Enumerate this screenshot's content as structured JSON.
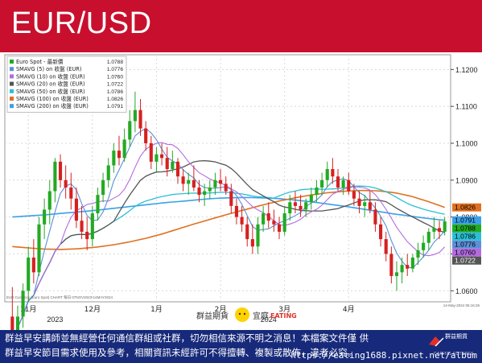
{
  "header": {
    "title": "EUR/USD",
    "bg_color": "#c8102e"
  },
  "chart_data": {
    "type": "line",
    "candles": [
      {
        "o": 1.053,
        "h": 1.061,
        "l": 1.045,
        "c": 1.047
      },
      {
        "o": 1.047,
        "h": 1.056,
        "l": 1.044,
        "c": 1.053
      },
      {
        "o": 1.053,
        "h": 1.062,
        "l": 1.05,
        "c": 1.06
      },
      {
        "o": 1.06,
        "h": 1.072,
        "l": 1.057,
        "c": 1.069
      },
      {
        "o": 1.069,
        "h": 1.074,
        "l": 1.062,
        "c": 1.065
      },
      {
        "o": 1.065,
        "h": 1.08,
        "l": 1.064,
        "c": 1.078
      },
      {
        "o": 1.078,
        "h": 1.085,
        "l": 1.074,
        "c": 1.082
      },
      {
        "o": 1.082,
        "h": 1.09,
        "l": 1.078,
        "c": 1.087
      },
      {
        "o": 1.087,
        "h": 1.096,
        "l": 1.084,
        "c": 1.095
      },
      {
        "o": 1.095,
        "h": 1.097,
        "l": 1.088,
        "c": 1.09
      },
      {
        "o": 1.09,
        "h": 1.094,
        "l": 1.085,
        "c": 1.088
      },
      {
        "o": 1.088,
        "h": 1.092,
        "l": 1.082,
        "c": 1.085
      },
      {
        "o": 1.085,
        "h": 1.088,
        "l": 1.077,
        "c": 1.079
      },
      {
        "o": 1.079,
        "h": 1.083,
        "l": 1.074,
        "c": 1.076
      },
      {
        "o": 1.076,
        "h": 1.08,
        "l": 1.071,
        "c": 1.074
      },
      {
        "o": 1.074,
        "h": 1.083,
        "l": 1.072,
        "c": 1.081
      },
      {
        "o": 1.081,
        "h": 1.088,
        "l": 1.079,
        "c": 1.086
      },
      {
        "o": 1.086,
        "h": 1.092,
        "l": 1.084,
        "c": 1.09
      },
      {
        "o": 1.09,
        "h": 1.096,
        "l": 1.088,
        "c": 1.094
      },
      {
        "o": 1.094,
        "h": 1.1,
        "l": 1.092,
        "c": 1.098
      },
      {
        "o": 1.098,
        "h": 1.102,
        "l": 1.094,
        "c": 1.096
      },
      {
        "o": 1.096,
        "h": 1.104,
        "l": 1.095,
        "c": 1.101
      },
      {
        "o": 1.101,
        "h": 1.109,
        "l": 1.099,
        "c": 1.106
      },
      {
        "o": 1.106,
        "h": 1.114,
        "l": 1.103,
        "c": 1.109
      },
      {
        "o": 1.109,
        "h": 1.112,
        "l": 1.102,
        "c": 1.104
      },
      {
        "o": 1.104,
        "h": 1.106,
        "l": 1.098,
        "c": 1.1
      },
      {
        "o": 1.1,
        "h": 1.102,
        "l": 1.093,
        "c": 1.095
      },
      {
        "o": 1.095,
        "h": 1.099,
        "l": 1.092,
        "c": 1.097
      },
      {
        "o": 1.097,
        "h": 1.1,
        "l": 1.094,
        "c": 1.096
      },
      {
        "o": 1.096,
        "h": 1.099,
        "l": 1.091,
        "c": 1.093
      },
      {
        "o": 1.093,
        "h": 1.098,
        "l": 1.092,
        "c": 1.095
      },
      {
        "o": 1.095,
        "h": 1.096,
        "l": 1.089,
        "c": 1.091
      },
      {
        "o": 1.091,
        "h": 1.093,
        "l": 1.087,
        "c": 1.089
      },
      {
        "o": 1.089,
        "h": 1.092,
        "l": 1.086,
        "c": 1.09
      },
      {
        "o": 1.09,
        "h": 1.094,
        "l": 1.087,
        "c": 1.088
      },
      {
        "o": 1.088,
        "h": 1.09,
        "l": 1.084,
        "c": 1.086
      },
      {
        "o": 1.086,
        "h": 1.089,
        "l": 1.083,
        "c": 1.087
      },
      {
        "o": 1.087,
        "h": 1.09,
        "l": 1.085,
        "c": 1.088
      },
      {
        "o": 1.088,
        "h": 1.092,
        "l": 1.086,
        "c": 1.09
      },
      {
        "o": 1.09,
        "h": 1.093,
        "l": 1.087,
        "c": 1.089
      },
      {
        "o": 1.089,
        "h": 1.091,
        "l": 1.086,
        "c": 1.087
      },
      {
        "o": 1.087,
        "h": 1.089,
        "l": 1.081,
        "c": 1.083
      },
      {
        "o": 1.083,
        "h": 1.085,
        "l": 1.078,
        "c": 1.08
      },
      {
        "o": 1.08,
        "h": 1.083,
        "l": 1.076,
        "c": 1.078
      },
      {
        "o": 1.078,
        "h": 1.08,
        "l": 1.072,
        "c": 1.074
      },
      {
        "o": 1.074,
        "h": 1.078,
        "l": 1.07,
        "c": 1.072
      },
      {
        "o": 1.072,
        "h": 1.08,
        "l": 1.07,
        "c": 1.078
      },
      {
        "o": 1.078,
        "h": 1.083,
        "l": 1.076,
        "c": 1.081
      },
      {
        "o": 1.081,
        "h": 1.084,
        "l": 1.077,
        "c": 1.079
      },
      {
        "o": 1.079,
        "h": 1.082,
        "l": 1.076,
        "c": 1.078
      },
      {
        "o": 1.078,
        "h": 1.08,
        "l": 1.074,
        "c": 1.076
      },
      {
        "o": 1.076,
        "h": 1.083,
        "l": 1.075,
        "c": 1.081
      },
      {
        "o": 1.081,
        "h": 1.086,
        "l": 1.079,
        "c": 1.084
      },
      {
        "o": 1.084,
        "h": 1.087,
        "l": 1.081,
        "c": 1.083
      },
      {
        "o": 1.083,
        "h": 1.086,
        "l": 1.08,
        "c": 1.082
      },
      {
        "o": 1.082,
        "h": 1.085,
        "l": 1.08,
        "c": 1.084
      },
      {
        "o": 1.084,
        "h": 1.088,
        "l": 1.082,
        "c": 1.086
      },
      {
        "o": 1.086,
        "h": 1.09,
        "l": 1.084,
        "c": 1.088
      },
      {
        "o": 1.088,
        "h": 1.092,
        "l": 1.086,
        "c": 1.09
      },
      {
        "o": 1.09,
        "h": 1.095,
        "l": 1.088,
        "c": 1.093
      },
      {
        "o": 1.093,
        "h": 1.096,
        "l": 1.089,
        "c": 1.091
      },
      {
        "o": 1.091,
        "h": 1.093,
        "l": 1.087,
        "c": 1.088
      },
      {
        "o": 1.088,
        "h": 1.091,
        "l": 1.086,
        "c": 1.09
      },
      {
        "o": 1.09,
        "h": 1.092,
        "l": 1.086,
        "c": 1.087
      },
      {
        "o": 1.087,
        "h": 1.089,
        "l": 1.083,
        "c": 1.085
      },
      {
        "o": 1.085,
        "h": 1.087,
        "l": 1.081,
        "c": 1.083
      },
      {
        "o": 1.083,
        "h": 1.086,
        "l": 1.08,
        "c": 1.084
      },
      {
        "o": 1.084,
        "h": 1.087,
        "l": 1.081,
        "c": 1.082
      },
      {
        "o": 1.082,
        "h": 1.084,
        "l": 1.076,
        "c": 1.078
      },
      {
        "o": 1.078,
        "h": 1.08,
        "l": 1.072,
        "c": 1.074
      },
      {
        "o": 1.074,
        "h": 1.076,
        "l": 1.068,
        "c": 1.07
      },
      {
        "o": 1.07,
        "h": 1.072,
        "l": 1.062,
        "c": 1.064
      },
      {
        "o": 1.064,
        "h": 1.068,
        "l": 1.06,
        "c": 1.065
      },
      {
        "o": 1.065,
        "h": 1.069,
        "l": 1.062,
        "c": 1.067
      },
      {
        "o": 1.067,
        "h": 1.07,
        "l": 1.064,
        "c": 1.066
      },
      {
        "o": 1.066,
        "h": 1.07,
        "l": 1.065,
        "c": 1.069
      },
      {
        "o": 1.069,
        "h": 1.073,
        "l": 1.067,
        "c": 1.071
      },
      {
        "o": 1.071,
        "h": 1.075,
        "l": 1.069,
        "c": 1.073
      },
      {
        "o": 1.073,
        "h": 1.077,
        "l": 1.071,
        "c": 1.076
      },
      {
        "o": 1.076,
        "h": 1.08,
        "l": 1.074,
        "c": 1.077
      },
      {
        "o": 1.077,
        "h": 1.079,
        "l": 1.074,
        "c": 1.076
      },
      {
        "o": 1.076,
        "h": 1.08,
        "l": 1.075,
        "c": 1.0788
      }
    ],
    "series": [
      {
        "name": "Euro Spot - 最新價",
        "last": "1.0788",
        "color": "#22aa22",
        "kind": "candle"
      },
      {
        "name": "SMAVG (5) on 收盤 (EUR)",
        "last": "1.0776",
        "color": "#5b8fd6",
        "kind": "line"
      },
      {
        "name": "SMAVG (10) on 收盤 (EUR)",
        "last": "1.0760",
        "color": "#b36be0",
        "kind": "line"
      },
      {
        "name": "SMAVG (20) on 收盤 (EUR)",
        "last": "1.0722",
        "color": "#555555",
        "kind": "line"
      },
      {
        "name": "SMAVG (50) on 收盤 (EUR)",
        "last": "1.0786",
        "color": "#2bbfd6",
        "kind": "line"
      },
      {
        "name": "SMAVG (100) on 收盤 (EUR)",
        "last": "1.0826",
        "color": "#e07020",
        "kind": "line"
      },
      {
        "name": "SMAVG (200) on 收盤 (EUR)",
        "last": "1.0791",
        "color": "#3aa0e8",
        "kind": "line"
      }
    ],
    "ma200": [
      1.08,
      1.0803,
      1.0806,
      1.081,
      1.0814,
      1.0818,
      1.0823,
      1.0828,
      1.0833,
      1.0838,
      1.0842,
      1.0846,
      1.085,
      1.0852,
      1.0853,
      1.0852,
      1.085,
      1.0846,
      1.0841,
      1.0835,
      1.0829,
      1.0822,
      1.0815,
      1.0808,
      1.0802,
      1.0796,
      1.0791
    ],
    "ma100": [
      1.072,
      1.0716,
      1.0713,
      1.0712,
      1.0714,
      1.0718,
      1.0724,
      1.0732,
      1.0742,
      1.0754,
      1.0768,
      1.0782,
      1.0795,
      1.0808,
      1.082,
      1.0832,
      1.0843,
      1.0852,
      1.086,
      1.0866,
      1.087,
      1.0872,
      1.0871,
      1.0866,
      1.0856,
      1.0842,
      1.0826
    ],
    "y_ticks": [
      1.06,
      1.07,
      1.08,
      1.09,
      1.1,
      1.11,
      1.12
    ],
    "y_tick_labels": [
      "1.0600",
      "1.0700",
      "1.0800",
      "1.0900",
      "1.1000",
      "1.1100",
      "1.1200"
    ],
    "ylim": [
      1.057,
      1.124
    ],
    "x_ticks": [
      {
        "label": "11月",
        "index": 3
      },
      {
        "label": "12月",
        "index": 15
      },
      {
        "label": "1月",
        "index": 27
      },
      {
        "label": "2月",
        "index": 39
      },
      {
        "label": "3月",
        "index": 51
      },
      {
        "label": "4月",
        "index": 63
      }
    ],
    "year_labels": [
      {
        "label": "2023",
        "index": 8
      },
      {
        "label": "2024",
        "index": 48
      }
    ],
    "price_tags": [
      {
        "value": 1.0826,
        "text": "1.0826",
        "bg": "#e07020",
        "fg": "#000000"
      },
      {
        "value": 1.0791,
        "text": "1.0791",
        "bg": "#3aa0e8",
        "fg": "#000000"
      },
      {
        "value": 1.0788,
        "text": "1.0788",
        "bg": "#22aa22",
        "fg": "#000000"
      },
      {
        "value": 1.0786,
        "text": "1.0786",
        "bg": "#2bbfd6",
        "fg": "#000000"
      },
      {
        "value": 1.0776,
        "text": "1.0776",
        "bg": "#5b8fd6",
        "fg": "#000000"
      },
      {
        "value": 1.076,
        "text": "1.0760",
        "bg": "#b36be0",
        "fg": "#000000"
      },
      {
        "value": 1.0722,
        "text": "1.0722",
        "bg": "#555555",
        "fg": "#ffffff"
      }
    ],
    "source_note": "EUR Currency (Euro Spot) CHART 每日 07NOV2023-14MAY2024",
    "date_stamp": "14-May-2024 05:16:26",
    "grid": true,
    "legend_position": "top-left"
  },
  "watermark": {
    "text_left": "群益期貨",
    "text_right": "宜庭",
    "text_brand": "EATING"
  },
  "footer": {
    "disclaimer_line1": "群益早安講師並無經營任何通信群組或社群，切勿相信來源不明之消息！本檔案文件僅 供",
    "disclaimer_line2": "群益早安節目需求使用及參考，相關資訊未經許可不得擅轉、複製或散佈，違者必究。",
    "url": "https://eating1688.pixnet.net/album",
    "logo_text": "群益期貨",
    "logo_sub": "CAPITAL FUTURES",
    "bg_color": "#17297a"
  }
}
